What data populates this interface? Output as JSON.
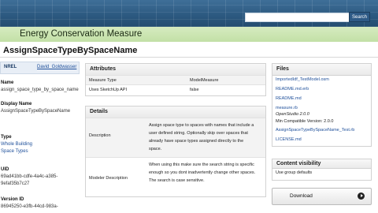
{
  "search": {
    "placeholder": "",
    "button_label": "Search"
  },
  "header": {
    "title": "Energy Conservation Measure"
  },
  "page": {
    "title": "AssignSpaceTypeBySpaceName"
  },
  "sidebar": {
    "tab": "NREL",
    "user": "David_Goldwasser",
    "name_label": "Name",
    "name_value": "assign_space_type_by_space_name",
    "display_label": "Display Name",
    "display_value": "AssignSpaceTypeBySpaceName",
    "type_label": "Type",
    "type_links": [
      "Whole Building",
      "Space Types"
    ],
    "uid_label": "UID",
    "uid_lines": [
      "69ad41bb-cdfe-4a4c-a385-",
      "9efaf35b7c27"
    ],
    "version_label": "Version ID",
    "version_lines": [
      "86945250-e3fb-44cd-983a-"
    ]
  },
  "attributes": {
    "heading": "Attributes",
    "rows": [
      {
        "key": "Measure Type",
        "value": "ModelMeasure"
      },
      {
        "key": "Uses SketchUp API",
        "value": "false"
      }
    ]
  },
  "details": {
    "heading": "Details",
    "rows": [
      {
        "key": "Description",
        "lines": [
          "Assign space type to spaces with names that include a",
          "user defined string. Optionally skip over spaces that",
          "already have space types assigned directly to the",
          "space."
        ]
      },
      {
        "key": "Modeler Description",
        "lines": [
          "When using this make sure the search string is specific",
          "enough so you dont inadvertently change other spaces.",
          "The search is case sensitive."
        ]
      }
    ]
  },
  "files": {
    "heading": "Files",
    "items": [
      "ImportedIdf_TestModel.osm",
      "README.md.erb",
      "README.md",
      "measure.rb"
    ],
    "os_version": "OpenStudio 2.0.0",
    "min_version": "Min Compatible Version: 2.0.0",
    "more_items": [
      "AssignSpaceTypeBySpaceName_Test.rb",
      "LICENSE.md"
    ]
  },
  "visibility": {
    "heading": "Content visibility",
    "value": "Use group defaults"
  },
  "download": {
    "label": "Download"
  }
}
